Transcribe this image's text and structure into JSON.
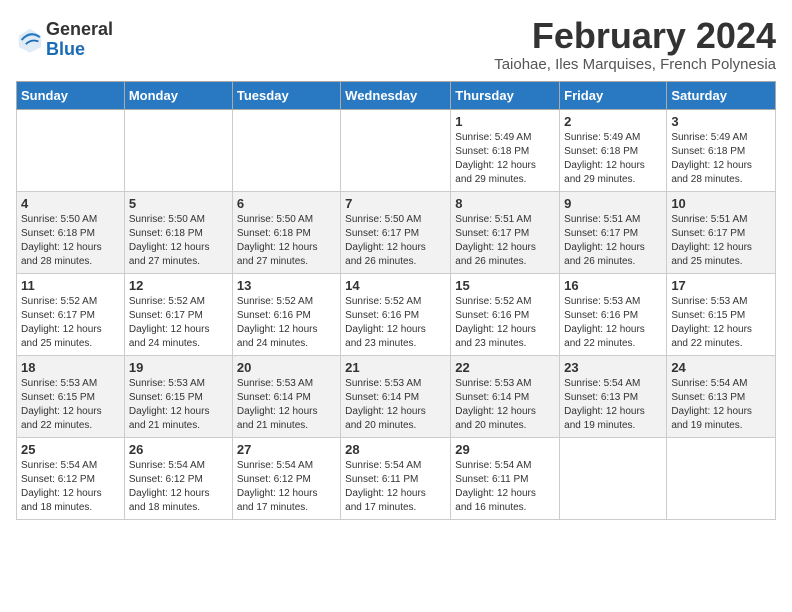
{
  "header": {
    "logo_general": "General",
    "logo_blue": "Blue",
    "month_title": "February 2024",
    "subtitle": "Taiohae, Iles Marquises, French Polynesia"
  },
  "weekdays": [
    "Sunday",
    "Monday",
    "Tuesday",
    "Wednesday",
    "Thursday",
    "Friday",
    "Saturday"
  ],
  "weeks": [
    [
      {
        "day": "",
        "info": ""
      },
      {
        "day": "",
        "info": ""
      },
      {
        "day": "",
        "info": ""
      },
      {
        "day": "",
        "info": ""
      },
      {
        "day": "1",
        "info": "Sunrise: 5:49 AM\nSunset: 6:18 PM\nDaylight: 12 hours\nand 29 minutes."
      },
      {
        "day": "2",
        "info": "Sunrise: 5:49 AM\nSunset: 6:18 PM\nDaylight: 12 hours\nand 29 minutes."
      },
      {
        "day": "3",
        "info": "Sunrise: 5:49 AM\nSunset: 6:18 PM\nDaylight: 12 hours\nand 28 minutes."
      }
    ],
    [
      {
        "day": "4",
        "info": "Sunrise: 5:50 AM\nSunset: 6:18 PM\nDaylight: 12 hours\nand 28 minutes."
      },
      {
        "day": "5",
        "info": "Sunrise: 5:50 AM\nSunset: 6:18 PM\nDaylight: 12 hours\nand 27 minutes."
      },
      {
        "day": "6",
        "info": "Sunrise: 5:50 AM\nSunset: 6:18 PM\nDaylight: 12 hours\nand 27 minutes."
      },
      {
        "day": "7",
        "info": "Sunrise: 5:50 AM\nSunset: 6:17 PM\nDaylight: 12 hours\nand 26 minutes."
      },
      {
        "day": "8",
        "info": "Sunrise: 5:51 AM\nSunset: 6:17 PM\nDaylight: 12 hours\nand 26 minutes."
      },
      {
        "day": "9",
        "info": "Sunrise: 5:51 AM\nSunset: 6:17 PM\nDaylight: 12 hours\nand 26 minutes."
      },
      {
        "day": "10",
        "info": "Sunrise: 5:51 AM\nSunset: 6:17 PM\nDaylight: 12 hours\nand 25 minutes."
      }
    ],
    [
      {
        "day": "11",
        "info": "Sunrise: 5:52 AM\nSunset: 6:17 PM\nDaylight: 12 hours\nand 25 minutes."
      },
      {
        "day": "12",
        "info": "Sunrise: 5:52 AM\nSunset: 6:17 PM\nDaylight: 12 hours\nand 24 minutes."
      },
      {
        "day": "13",
        "info": "Sunrise: 5:52 AM\nSunset: 6:16 PM\nDaylight: 12 hours\nand 24 minutes."
      },
      {
        "day": "14",
        "info": "Sunrise: 5:52 AM\nSunset: 6:16 PM\nDaylight: 12 hours\nand 23 minutes."
      },
      {
        "day": "15",
        "info": "Sunrise: 5:52 AM\nSunset: 6:16 PM\nDaylight: 12 hours\nand 23 minutes."
      },
      {
        "day": "16",
        "info": "Sunrise: 5:53 AM\nSunset: 6:16 PM\nDaylight: 12 hours\nand 22 minutes."
      },
      {
        "day": "17",
        "info": "Sunrise: 5:53 AM\nSunset: 6:15 PM\nDaylight: 12 hours\nand 22 minutes."
      }
    ],
    [
      {
        "day": "18",
        "info": "Sunrise: 5:53 AM\nSunset: 6:15 PM\nDaylight: 12 hours\nand 22 minutes."
      },
      {
        "day": "19",
        "info": "Sunrise: 5:53 AM\nSunset: 6:15 PM\nDaylight: 12 hours\nand 21 minutes."
      },
      {
        "day": "20",
        "info": "Sunrise: 5:53 AM\nSunset: 6:14 PM\nDaylight: 12 hours\nand 21 minutes."
      },
      {
        "day": "21",
        "info": "Sunrise: 5:53 AM\nSunset: 6:14 PM\nDaylight: 12 hours\nand 20 minutes."
      },
      {
        "day": "22",
        "info": "Sunrise: 5:53 AM\nSunset: 6:14 PM\nDaylight: 12 hours\nand 20 minutes."
      },
      {
        "day": "23",
        "info": "Sunrise: 5:54 AM\nSunset: 6:13 PM\nDaylight: 12 hours\nand 19 minutes."
      },
      {
        "day": "24",
        "info": "Sunrise: 5:54 AM\nSunset: 6:13 PM\nDaylight: 12 hours\nand 19 minutes."
      }
    ],
    [
      {
        "day": "25",
        "info": "Sunrise: 5:54 AM\nSunset: 6:12 PM\nDaylight: 12 hours\nand 18 minutes."
      },
      {
        "day": "26",
        "info": "Sunrise: 5:54 AM\nSunset: 6:12 PM\nDaylight: 12 hours\nand 18 minutes."
      },
      {
        "day": "27",
        "info": "Sunrise: 5:54 AM\nSunset: 6:12 PM\nDaylight: 12 hours\nand 17 minutes."
      },
      {
        "day": "28",
        "info": "Sunrise: 5:54 AM\nSunset: 6:11 PM\nDaylight: 12 hours\nand 17 minutes."
      },
      {
        "day": "29",
        "info": "Sunrise: 5:54 AM\nSunset: 6:11 PM\nDaylight: 12 hours\nand 16 minutes."
      },
      {
        "day": "",
        "info": ""
      },
      {
        "day": "",
        "info": ""
      }
    ]
  ]
}
